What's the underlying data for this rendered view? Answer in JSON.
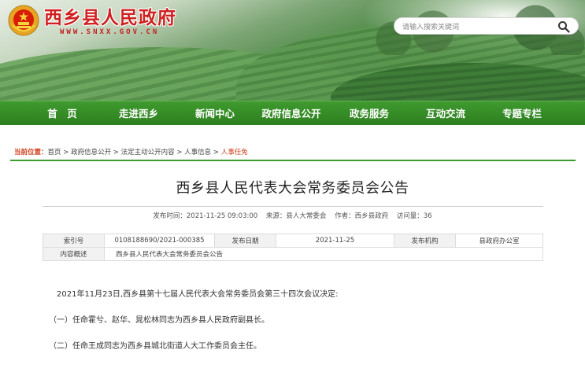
{
  "header": {
    "site_title": "西乡县人民政府",
    "site_url": "WWW.SNXX.GOV.CN",
    "search": {
      "placeholder": "请输入搜索关键词"
    }
  },
  "nav": {
    "items": [
      {
        "label": "首　页"
      },
      {
        "label": "走进西乡"
      },
      {
        "label": "新闻中心"
      },
      {
        "label": "政府信息公开"
      },
      {
        "label": "政务服务"
      },
      {
        "label": "互动交流"
      },
      {
        "label": "专题专栏"
      }
    ]
  },
  "breadcrumb": {
    "lead": "当前位置：",
    "items": [
      "首页",
      "政府信息公开",
      "法定主动公开内容",
      "人事信息"
    ],
    "separator": " > ",
    "current": "人事任免"
  },
  "article": {
    "title": "西乡县人民代表大会常务委员会公告",
    "meta": {
      "published": "发布时间：2021-11-25 09:03:00",
      "source": "来源：县人大常委会",
      "author": "作者：西乡县政府",
      "views": "访问量：36"
    },
    "info": {
      "index_label": "索引号",
      "index_value": "0108188690/2021-000385",
      "date_label": "发布日期",
      "date_value": "2021-11-25",
      "org_label": "发布机构",
      "org_value": "县政府办公室",
      "summary_label": "内容概述",
      "summary_value": "西乡县人民代表大会常务委员会公告"
    },
    "paragraphs": [
      "2021年11月23日,西乡县第十七届人民代表大会常务委员会第三十四次会议决定:",
      "（一）任命霍兮、赵华、晁松林同志为西乡县人民政府副县长。",
      "（二）任命王成同志为西乡县城北街道人大工作委员会主任。"
    ]
  },
  "colors": {
    "nav_green": "#2d7f1f",
    "title_red": "#d01f1f",
    "accent_orange": "#d03a1a"
  }
}
